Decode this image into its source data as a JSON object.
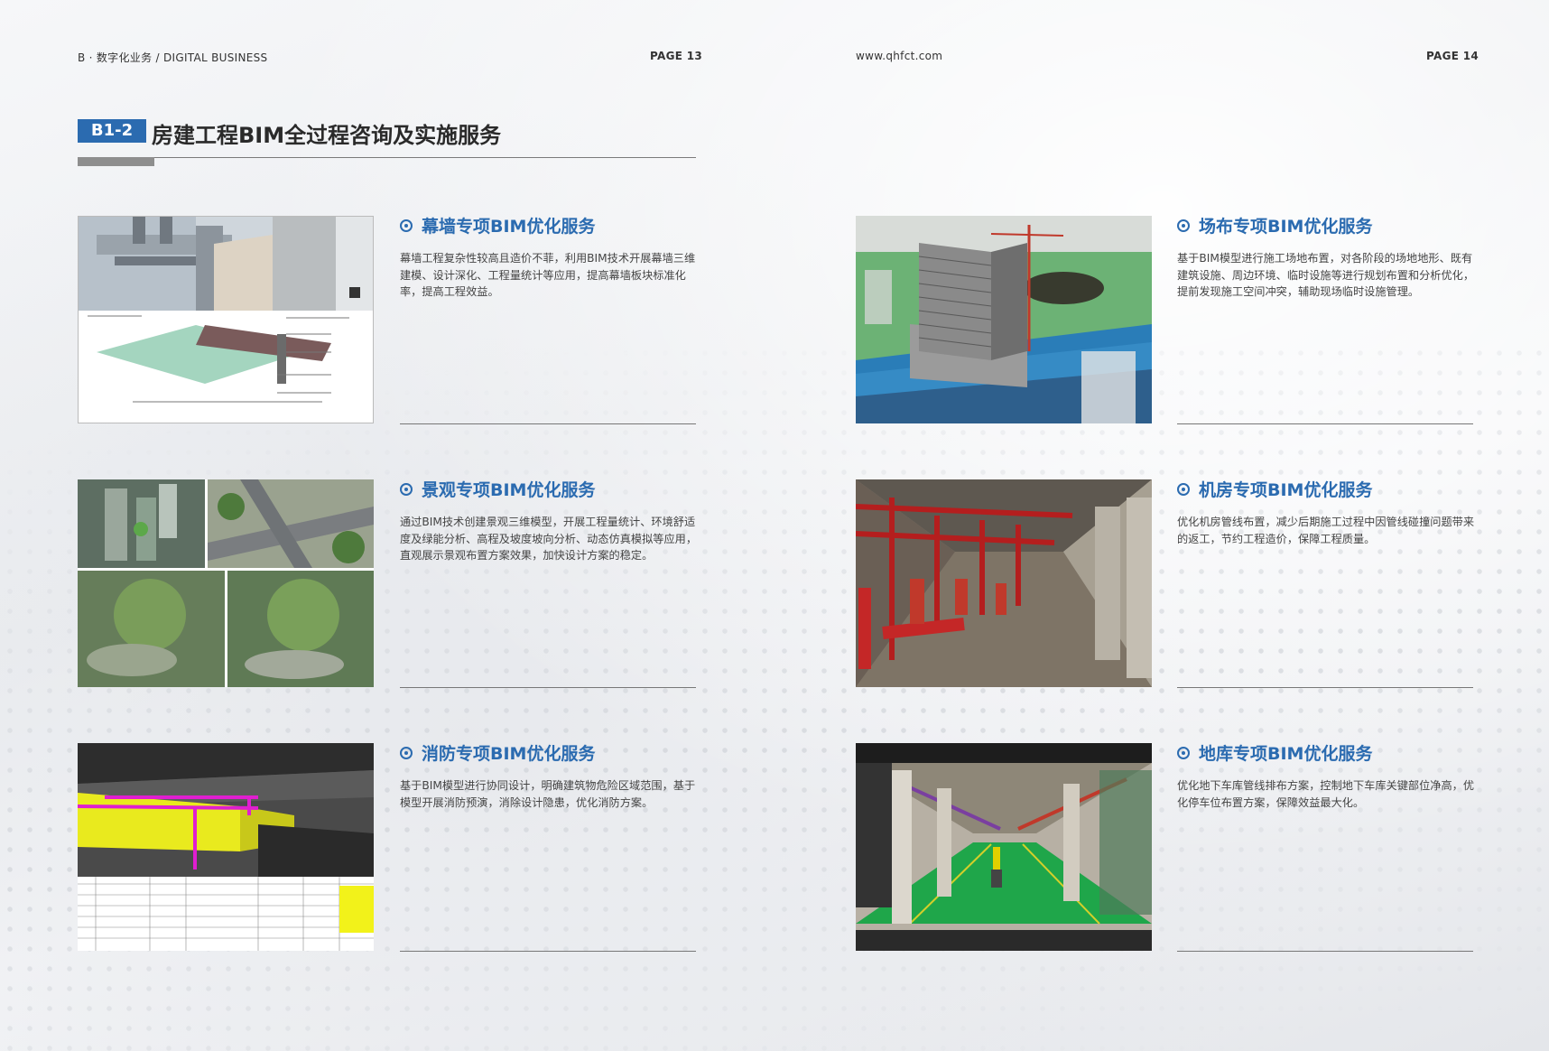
{
  "header": {
    "left_prefix": "B · 数字化业务",
    "left_suffix": "/  DIGITAL BUSINESS",
    "page_left": "PAGE  13",
    "website": "www.qhfct.com",
    "page_right": "PAGE  14"
  },
  "section": {
    "badge": "B1-2",
    "title": "房建工程BIM全过程咨询及实施服务"
  },
  "services": [
    {
      "title": "幕墙专项BIM优化服务",
      "desc": "幕墙工程复杂性较高且造价不菲，利用BIM技术开展幕墙三维建模、设计深化、工程量统计等应用，提高幕墙板块标准化率，提高工程效益。"
    },
    {
      "title": "场布专项BIM优化服务",
      "desc": "基于BIM模型进行施工场地布置，对各阶段的场地地形、既有建筑设施、周边环境、临时设施等进行规划布置和分析优化，提前发现施工空间冲突，辅助现场临时设施管理。"
    },
    {
      "title": "景观专项BIM优化服务",
      "desc": "通过BIM技术创建景观三维模型，开展工程量统计、环境舒适度及绿能分析、高程及坡度坡向分析、动态仿真模拟等应用，直观展示景观布置方案效果，加快设计方案的稳定。"
    },
    {
      "title": "机房专项BIM优化服务",
      "desc": "优化机房管线布置，减少后期施工过程中因管线碰撞问题带来的返工，节约工程造价，保障工程质量。"
    },
    {
      "title": "消防专项BIM优化服务",
      "desc": "基于BIM模型进行协同设计，明确建筑物危险区域范围，基于模型开展消防预演，消除设计隐患，优化消防方案。"
    },
    {
      "title": "地库专项BIM优化服务",
      "desc": "优化地下车库管线排布方案，控制地下车库关键部位净高，优化停车位布置方案，保障效益最大化。"
    }
  ],
  "colors": {
    "accent": "#2b6bb0",
    "fire_pipe": "#b01818",
    "floor_green": "#1fa64a"
  }
}
